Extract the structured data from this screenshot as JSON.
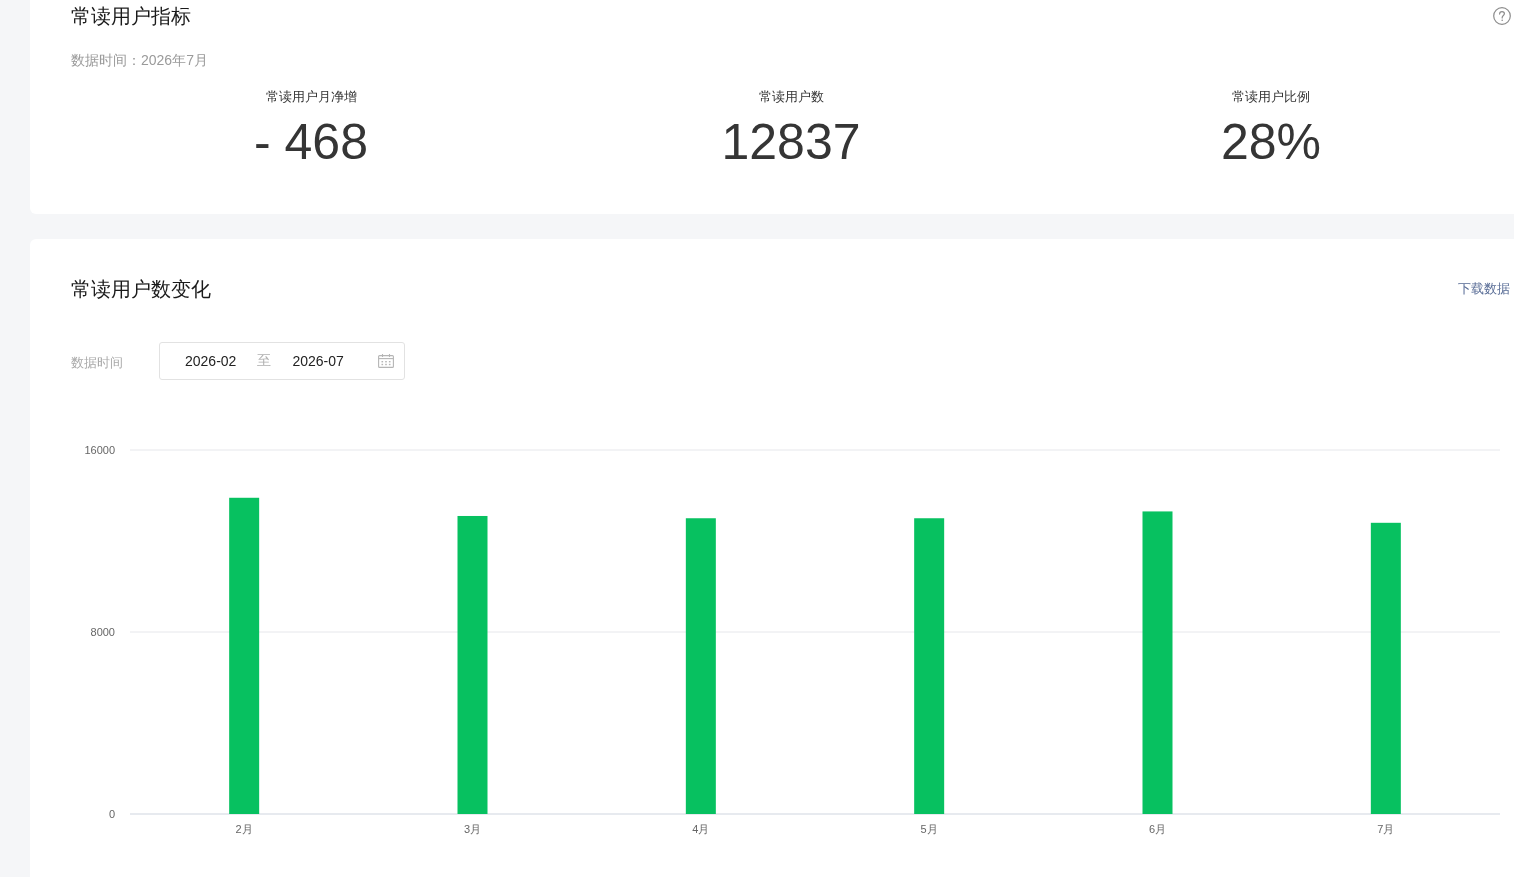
{
  "metrics_card": {
    "title": "常读用户指标",
    "data_time": "数据时间：2026年7月",
    "metrics": [
      {
        "label": "常读用户月净增",
        "value": "- 468"
      },
      {
        "label": "常读用户数",
        "value": "12837"
      },
      {
        "label": "常读用户比例",
        "value": "28%"
      }
    ]
  },
  "trend_card": {
    "title": "常读用户数变化",
    "download_link": "下载数据",
    "filter": {
      "label": "数据时间",
      "start": "2026-02",
      "separator": "至",
      "end": "2026-07"
    },
    "chart_data": {
      "type": "bar",
      "categories": [
        "2月",
        "3月",
        "4月",
        "5月",
        "6月",
        "7月"
      ],
      "values": [
        13900,
        13100,
        13000,
        13000,
        13300,
        12800
      ],
      "ylim": [
        0,
        16000
      ],
      "yticks": [
        0,
        8000,
        16000
      ]
    }
  }
}
